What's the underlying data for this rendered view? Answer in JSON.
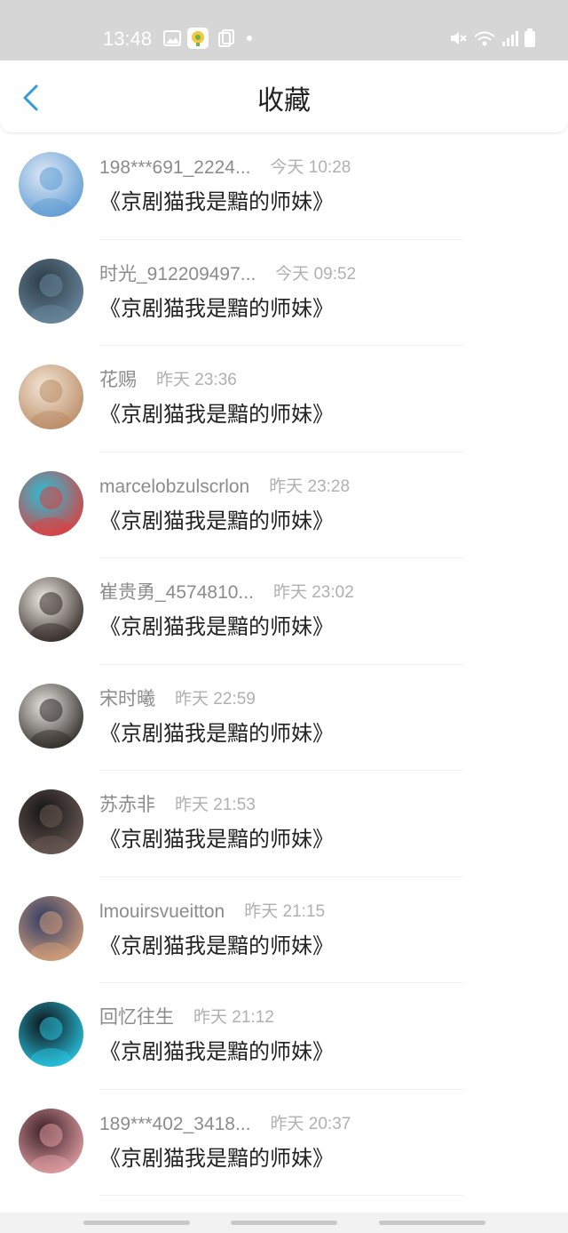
{
  "status_bar": {
    "time": "13:48",
    "icons": [
      "gallery-icon",
      "app-notification-icon",
      "copy-icon",
      "dot-icon",
      "mute-icon",
      "wifi-icon",
      "signal-icon",
      "battery-icon"
    ]
  },
  "header": {
    "title": "收藏",
    "back_icon": "chevron-left-icon",
    "accent": "#2f9bdc"
  },
  "favorites": [
    {
      "username": "198***691_2224...",
      "time": "今天 10:28",
      "content": "《京剧猫我是黯的师妹》",
      "avatar_colors": [
        "#dfe9f5",
        "#5d9bd3"
      ]
    },
    {
      "username": "时光_912209497...",
      "time": "今天 09:52",
      "content": "《京剧猫我是黯的师妹》",
      "avatar_colors": [
        "#2b3a44",
        "#6b8aa0"
      ]
    },
    {
      "username": "花赐",
      "time": "昨天 23:36",
      "content": "《京剧猫我是黯的师妹》",
      "avatar_colors": [
        "#f3e6d6",
        "#b98a64"
      ]
    },
    {
      "username": "marcelobzulscrlon",
      "time": "昨天 23:28",
      "content": "《京剧猫我是黯的师妹》",
      "avatar_colors": [
        "#27c1d8",
        "#e23b3b"
      ]
    },
    {
      "username": "崔贵勇_4574810...",
      "time": "昨天 23:02",
      "content": "《京剧猫我是黯的师妹》",
      "avatar_colors": [
        "#f2eee8",
        "#2e2522"
      ]
    },
    {
      "username": "宋时曦",
      "time": "昨天 22:59",
      "content": "《京剧猫我是黯的师妹》",
      "avatar_colors": [
        "#e9e6e1",
        "#2a2522"
      ]
    },
    {
      "username": "苏赤非",
      "time": "昨天 21:53",
      "content": "《京剧猫我是黯的师妹》",
      "avatar_colors": [
        "#141314",
        "#6d5c56"
      ]
    },
    {
      "username": "lmouirsvueitton",
      "time": "昨天 21:15",
      "content": "《京剧猫我是黯的师妹》",
      "avatar_colors": [
        "#2e3b66",
        "#d8a27a"
      ]
    },
    {
      "username": "回忆往生",
      "time": "昨天 21:12",
      "content": "《京剧猫我是黯的师妹》",
      "avatar_colors": [
        "#0e0f12",
        "#29c9e6"
      ]
    },
    {
      "username": "189***402_3418...",
      "time": "昨天 20:37",
      "content": "《京剧猫我是黯的师妹》",
      "avatar_colors": [
        "#3b1f27",
        "#e5a1a6"
      ]
    }
  ]
}
